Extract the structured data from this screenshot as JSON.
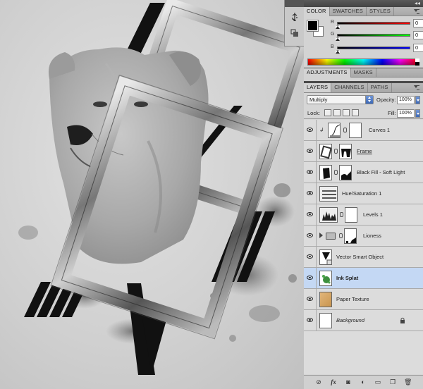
{
  "color_panel": {
    "tabs": [
      "COLOR",
      "SWATCHES",
      "STYLES"
    ],
    "active_tab": "COLOR",
    "channels": [
      {
        "label": "R",
        "value": "0",
        "gradient": "linear-gradient(to right,#000,#ff0000)"
      },
      {
        "label": "G",
        "value": "0",
        "gradient": "linear-gradient(to right,#000,#00ff00)"
      },
      {
        "label": "B",
        "value": "0",
        "gradient": "linear-gradient(to right,#000,#0000ff)"
      }
    ],
    "foreground": "#000000",
    "background": "#ffffff"
  },
  "adjustments_panel": {
    "tabs": [
      "ADJUSTMENTS",
      "MASKS"
    ]
  },
  "layers_panel": {
    "tabs": [
      "LAYERS",
      "CHANNELS",
      "PATHS"
    ],
    "blend_mode": "Multiply",
    "opacity_label": "Opacity:",
    "opacity_value": "100%",
    "lock_label": "Lock:",
    "fill_label": "Fill:",
    "fill_value": "100%",
    "layers": [
      {
        "name": "Curves 1",
        "kind": "adjustment-curves",
        "has_mask": true,
        "clipped": true
      },
      {
        "name": "Frame",
        "kind": "raster",
        "has_mask": true,
        "underline": true
      },
      {
        "name": "Black Fill - Soft Light",
        "kind": "raster",
        "has_mask": true
      },
      {
        "name": "Hue/Saturation 1",
        "kind": "adjustment-hue",
        "has_mask": false
      },
      {
        "name": "Levels 1",
        "kind": "adjustment-levels",
        "has_mask": true
      },
      {
        "name": "Lioness",
        "kind": "group",
        "has_mask": true
      },
      {
        "name": "Vector Smart Object",
        "kind": "smart-object",
        "has_mask": false
      },
      {
        "name": "Ink Splat",
        "kind": "raster",
        "has_mask": false,
        "selected": true,
        "bold": true
      },
      {
        "name": "Paper Texture",
        "kind": "raster",
        "has_mask": false
      },
      {
        "name": "Background",
        "kind": "background",
        "has_mask": false,
        "italic": true,
        "locked": true
      }
    ]
  }
}
